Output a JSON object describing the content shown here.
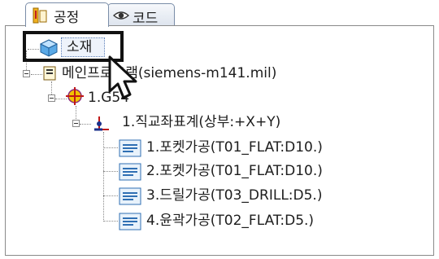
{
  "tabs": [
    {
      "label": "공정",
      "icon": "process-tab-icon",
      "active": true
    },
    {
      "label": "코드",
      "icon": "eye-icon",
      "active": false
    }
  ],
  "tree": {
    "material": "소재",
    "main_program": "메인프로그램(siemens-m141.mil)",
    "machine": "1.G54",
    "coordinate": "1.직교좌표계(상부:+X+Y)",
    "operations": [
      "1.포켓가공(T01_FLAT:D10.)",
      "2.포켓가공(T01_FLAT:D10.)",
      "3.드릴가공(T03_DRILL:D5.)",
      "4.윤곽가공(T02_FLAT:D5.)"
    ]
  },
  "colors": {
    "highlight_border": "#111111",
    "tab_border": "#7a8da8",
    "operation_icon": "#2f6fb3"
  }
}
